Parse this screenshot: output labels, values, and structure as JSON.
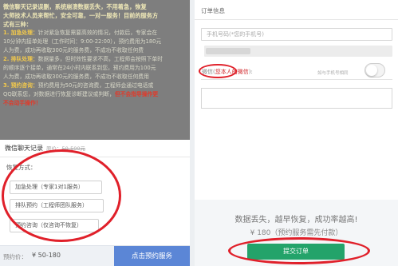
{
  "left": {
    "intro": {
      "line1": "微信聊天记录误删，系统崩溃数据丢失，不用着急，恢复",
      "line2": "大师技术人员来帮忙，安全可靠，一对一服务！目前的服务方",
      "line3": "式有三种：",
      "opt1_title": "1. 加急处理：",
      "opt1_text": "针对紧急恢复需要高效的情况，付款后，专家会在",
      "opt1_text2": "10分钟内接单处理（工作时间：9:00-22:00），预约费用为180元",
      "opt1_text3": "人为费，成功再收取300元的服务费，不成功不收取任何费",
      "opt2_title": "2. 排队处理：",
      "opt2_text": "数据量多，但时效性要求不高，工程师会按照下单时",
      "opt2_text2": "的顺序逐个接单，通常在24小时内联系到您，预约费用为100元",
      "opt2_text3": "人为费，成功再收取300元的服务费，不成功不收取任何费用",
      "opt3_title": "3. 预约咨询：",
      "opt3_text": "预约费用为50元的咨询费，工程师会通过电话或",
      "opt3_text2": "QQ联系您，对数据进行恢复诊断建议或判断，",
      "opt3_warn": "但不会指导操作更",
      "opt3_warn2": "不会动手操作！"
    },
    "service": {
      "title": "微信聊天记录",
      "orig_label": "原价：",
      "orig_price": "50-500元"
    },
    "plans_label": "恢复方式：",
    "plans": [
      "加急处理（专家1对1服务）",
      "排队预约（工程师团队服务）",
      "预约咨询（仅咨询不恢复）"
    ],
    "price_label": "预约价：",
    "price_value": "¥ 50-180",
    "book_button": "点击预约服务"
  },
  "right": {
    "form_title": "订单信息",
    "phone_placeholder": "手机号码(*您的手机号)",
    "wechat_label_prefix": "微信(",
    "wechat_label_red": "您本人的微信",
    "wechat_label_suffix": "):",
    "wechat_same": "如与手机号相同",
    "tagline": "数据丢失，越早恢复，成功率越高!",
    "pay_note": "¥ 180（预约服务需先付款）",
    "submit_button": "提交订单"
  },
  "colors": {
    "accent_blue": "#5b86d6",
    "submit_green": "#23a36a",
    "highlight_red": "#e0202a"
  }
}
